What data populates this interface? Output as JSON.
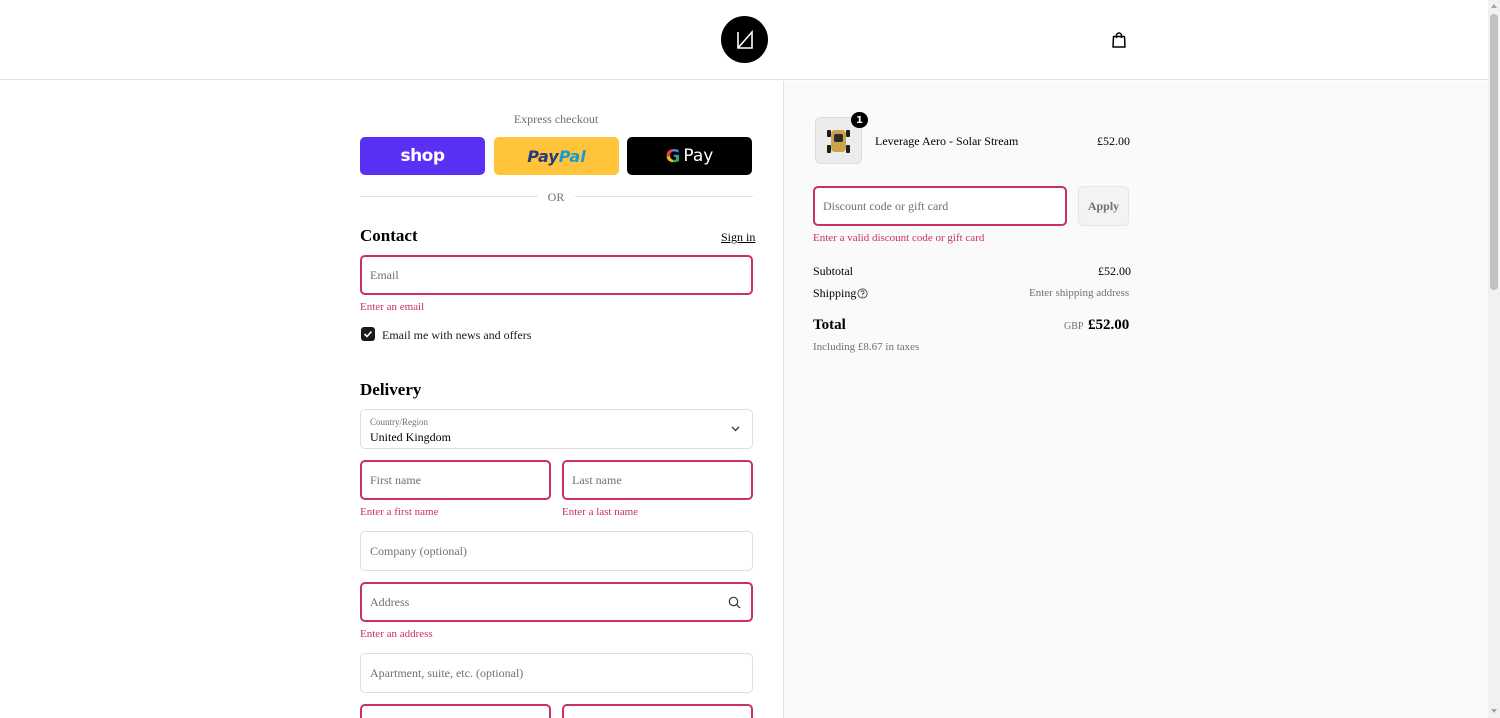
{
  "header": {
    "logo_icon": "logo-mark-icon",
    "cart_icon": "shopping-bag-icon"
  },
  "checkout": {
    "express_label": "Express checkout",
    "shop_label": "shop",
    "paypal_part1": "Pay",
    "paypal_part2": "Pal",
    "gpay_g": "G",
    "gpay_label": "Pay",
    "or_label": "OR"
  },
  "contact": {
    "title": "Contact",
    "sign_in": "Sign in",
    "email_placeholder": "Email",
    "email_error": "Enter an email",
    "news_checkbox_label": "Email me with news and offers",
    "news_checked": true
  },
  "delivery": {
    "title": "Delivery",
    "country_label": "Country/Region",
    "country_value": "United Kingdom",
    "first_name_placeholder": "First name",
    "first_name_error": "Enter a first name",
    "last_name_placeholder": "Last name",
    "last_name_error": "Enter a last name",
    "company_placeholder": "Company (optional)",
    "address_placeholder": "Address",
    "address_error": "Enter an address",
    "apartment_placeholder": "Apartment, suite, etc. (optional)"
  },
  "summary": {
    "item_name": "Leverage Aero - Solar Stream",
    "item_price": "£52.00",
    "item_qty": "1",
    "discount_placeholder": "Discount code or gift card",
    "apply_label": "Apply",
    "discount_error": "Enter a valid discount code or gift card",
    "subtotal_label": "Subtotal",
    "subtotal_value": "£52.00",
    "shipping_label": "Shipping",
    "shipping_value": "Enter shipping address",
    "total_label": "Total",
    "total_currency": "GBP",
    "total_value": "£52.00",
    "tax_note": "Including £8.67 in taxes"
  },
  "colors": {
    "error": "#c9306b",
    "shop": "#5a31f4",
    "paypal": "#ffc439",
    "gpay": "#000000"
  }
}
